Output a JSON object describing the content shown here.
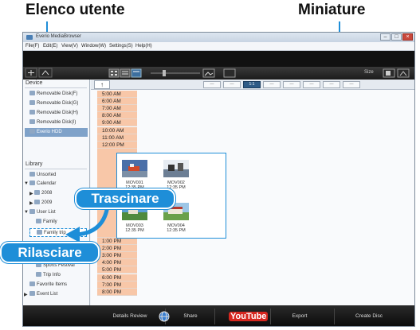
{
  "callouts": {
    "user_list": "Elenco utente",
    "thumbnails": "Miniature",
    "drag": "Trascinare",
    "drop": "Rilasciare"
  },
  "window": {
    "title": "Everio MediaBrowser",
    "menu": [
      "File(F)",
      "Edit(E)",
      "View(V)",
      "Window(W)",
      "Settings(S)",
      "Help(H)"
    ]
  },
  "sidebar": {
    "device_header": "Device",
    "devices": [
      "Removable Disk(F)",
      "Removable Disk(G)",
      "Removable Disk(H)",
      "Removable Disk(I)",
      "Everio HDD"
    ],
    "library_header": "Library",
    "library_items": [
      "Unsorted",
      "Calendar",
      "2008",
      "2009",
      "User List",
      "Family",
      "Family trip",
      "Sports Festival",
      "Trip Info",
      "Favorite Items",
      "Event List"
    ]
  },
  "viewbar": {
    "up_label": "↑",
    "tabs": [
      "—",
      "—",
      "1:1",
      "—",
      "—",
      "—",
      "—",
      "—"
    ],
    "selected_tab": 2,
    "size_label": "Size"
  },
  "times": [
    "5:00 AM",
    "6:00 AM",
    "7:00 AM",
    "8:00 AM",
    "9:00 AM",
    "10:00 AM",
    "11:00 AM",
    "12:00 PM",
    "1:00 PM",
    "2:00 PM",
    "3:00 PM",
    "4:00 PM",
    "5:00 PM",
    "6:00 PM",
    "7:00 PM",
    "8:00 PM"
  ],
  "thumbnails": [
    {
      "label": "MOV001",
      "time": "12:35 PM"
    },
    {
      "label": "MOV002",
      "time": "12:35 PM"
    },
    {
      "label": "MOV003",
      "time": "12:35 PM"
    },
    {
      "label": "MOV004",
      "time": "12:35 PM"
    }
  ],
  "bottombar": [
    "Details Review",
    "Share",
    "YouTube",
    "Export",
    "Create Disc"
  ],
  "colors": {
    "accent": "#1e8ed8",
    "selected_row": "#7fa2c9",
    "timeline_peach": "#f8c7a8"
  }
}
